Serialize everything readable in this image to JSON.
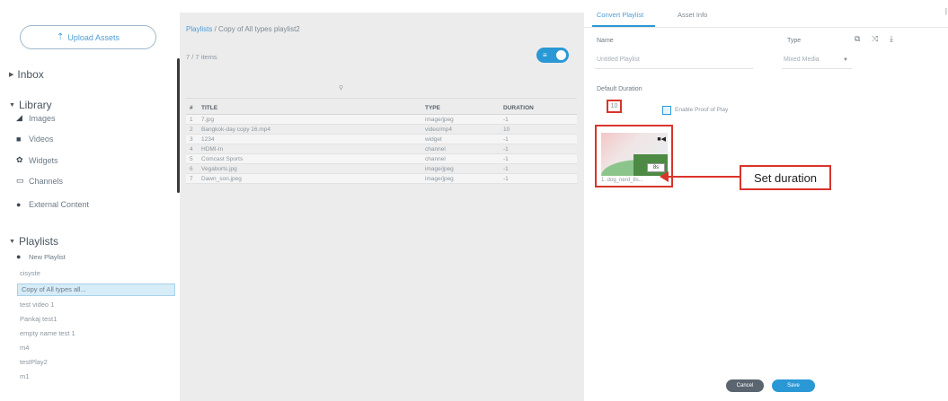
{
  "sidebar": {
    "upload_label": "Upload Assets",
    "inbox_label": "Inbox",
    "library_label": "Library",
    "library_items": [
      {
        "label": "Images",
        "icon": "images-icon"
      },
      {
        "label": "Videos",
        "icon": "video-icon"
      },
      {
        "label": "Widgets",
        "icon": "widget-icon"
      },
      {
        "label": "Channels",
        "icon": "channel-icon"
      },
      {
        "label": "External Content",
        "icon": "external-content-icon"
      }
    ],
    "playlists_label": "Playlists",
    "new_playlist_label": "New Playlist",
    "playlist_items": [
      "cisyste",
      "Copy of All types all...",
      "test video 1",
      "Pankaj test1",
      "empty name test 1",
      "m4",
      "testPlay2",
      "m1"
    ]
  },
  "middle": {
    "breadcrumb_root": "Playlists",
    "breadcrumb_sep": "/",
    "breadcrumb_current": "Copy of All types playlist2",
    "items_count": "7 / 7 items",
    "columns": [
      "#",
      "TITLE",
      "TYPE",
      "DURATION"
    ],
    "rows": [
      {
        "num": "1",
        "title": "7.jpg",
        "type": "image/jpeg",
        "duration": "-1"
      },
      {
        "num": "2",
        "title": "Bangkok-day copy 16.mp4",
        "type": "video/mp4",
        "duration": "10"
      },
      {
        "num": "3",
        "title": "1234",
        "type": "widget",
        "duration": "-1"
      },
      {
        "num": "4",
        "title": "HDMI-In",
        "type": "channel",
        "duration": "-1"
      },
      {
        "num": "5",
        "title": "Comcast Sports",
        "type": "channel",
        "duration": "-1"
      },
      {
        "num": "6",
        "title": "Vegaborts.jpg",
        "type": "image/jpeg",
        "duration": "-1"
      },
      {
        "num": "7",
        "title": "Dawn_son.jpeg",
        "type": "image/jpeg",
        "duration": "-1"
      }
    ]
  },
  "right": {
    "tab_convert": "Convert Playlist",
    "tab_asset_info": "Asset Info",
    "name_label": "Name",
    "name_value": "Untitled Playlist",
    "type_label": "Type",
    "type_value": "Mixed Media",
    "default_duration_label": "Default Duration",
    "default_duration_value": "10",
    "enable_proof_label": "Enable Proof of Play",
    "thumb_badge": "8s",
    "thumb_name": "1. dog_nerd_8s...",
    "callout_text": "Set duration",
    "cancel_label": "Cancel",
    "save_label": "Save"
  },
  "colors": {
    "accent": "#2b98d6",
    "annotation_red": "#d9342b",
    "panel_gray": "#ececec"
  }
}
